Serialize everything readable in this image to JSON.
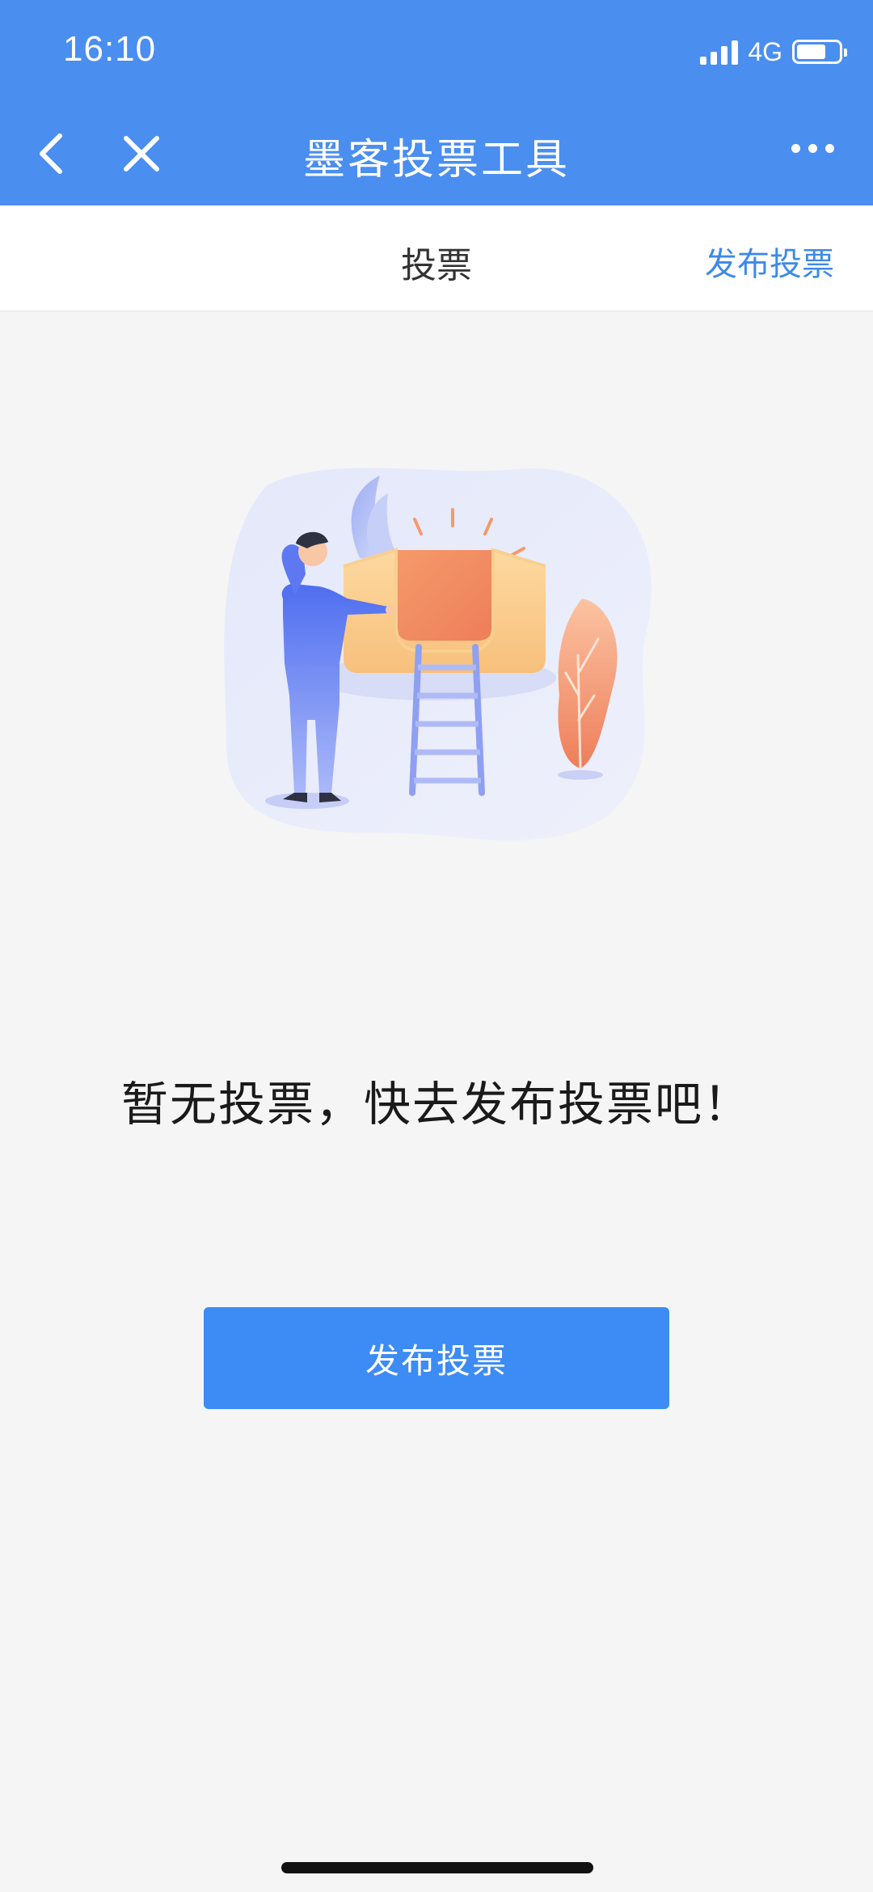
{
  "status_bar": {
    "time": "16:10",
    "network": "4G"
  },
  "nav": {
    "title": "墨客投票工具",
    "back_icon": "chevron-left-icon",
    "close_icon": "close-icon",
    "more_icon": "more-dots-icon"
  },
  "subheader": {
    "title": "投票",
    "action_label": "发布投票"
  },
  "empty_state": {
    "message": "暂无投票，快去发布投票吧！",
    "button_label": "发布投票"
  },
  "colors": {
    "primary": "#4a8ef0",
    "button": "#3d8bf4",
    "link": "#3e8ae8",
    "background": "#f5f5f5",
    "accent_orange": "#f08a64"
  }
}
